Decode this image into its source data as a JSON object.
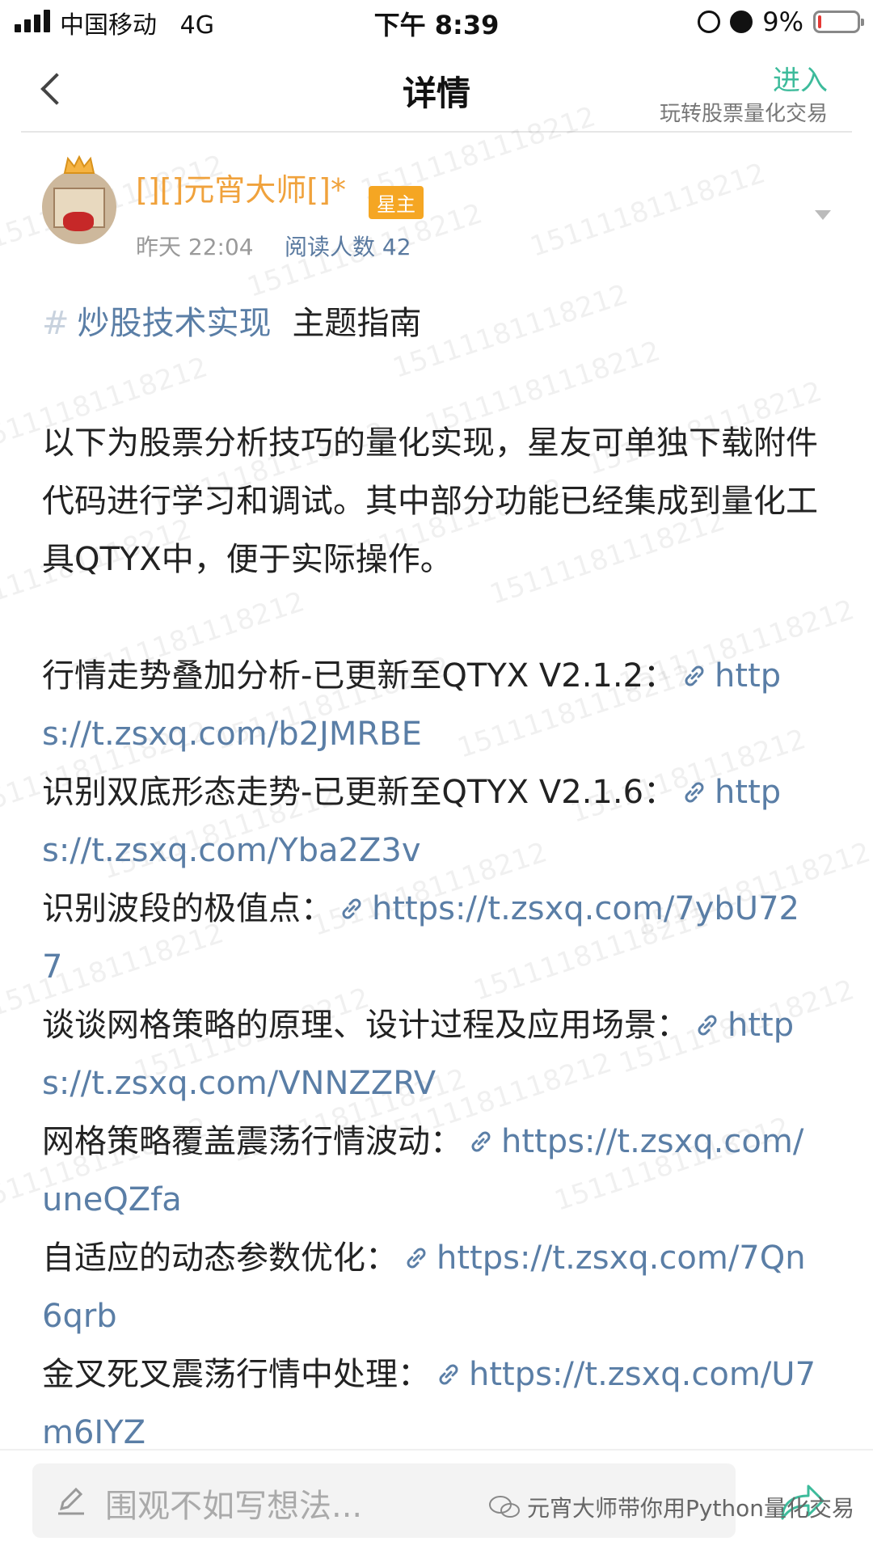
{
  "status_bar": {
    "carrier": "中国移动",
    "network": "4G",
    "time": "下午 8:39",
    "battery_percent": "9%",
    "battery_level": 0.09
  },
  "nav": {
    "title": "详情",
    "enter_label": "进入",
    "group_name": "玩转股票量化交易"
  },
  "post": {
    "author": "[][]元宵大师[]*",
    "badge": "星主",
    "time": "昨天 22:04",
    "read_count": "阅读人数 42",
    "topic_hash": "#",
    "topic": "炒股技术实现",
    "topic_suffix": "主题指南",
    "intro": "以下为股票分析技巧的量化实现，星友可单独下载附件代码进行学习和调试。其中部分功能已经集成到量化工具QTYX中，便于实际操作。",
    "entries": [
      {
        "title": "行情走势叠加分析-已更新至QTYX V2.1.2：",
        "url": "https://t.zsxq.com/b2JMRBE"
      },
      {
        "title": "识别双底形态走势-已更新至QTYX V2.1.6：",
        "url": "https://t.zsxq.com/Yba2Z3v"
      },
      {
        "title": "识别波段的极值点：",
        "url": "https://t.zsxq.com/7ybU727"
      },
      {
        "title": "谈谈网格策略的原理、设计过程及应用场景：",
        "url": "https://t.zsxq.com/VNNZZRV"
      },
      {
        "title": "网格策略覆盖震荡行情波动：",
        "url": "https://t.zsxq.com/uneQZfa"
      },
      {
        "title": "自适应的动态参数优化：",
        "url": "https://t.zsxq.com/7Qn6qrb"
      },
      {
        "title": "金叉死叉震荡行情中处理：",
        "url": "https://t.zsxq.com/U7m6IYZ"
      }
    ]
  },
  "bottom": {
    "comment_placeholder": "围观不如写想法...",
    "source_watermark": "元宵大师带你用Python量化交易"
  },
  "watermark_text": "15111181118212",
  "colors": {
    "accent_green": "#3dbb9b",
    "author_orange": "#f0a23c",
    "badge_orange": "#f5a623",
    "link_blue": "#5a7ea6"
  }
}
